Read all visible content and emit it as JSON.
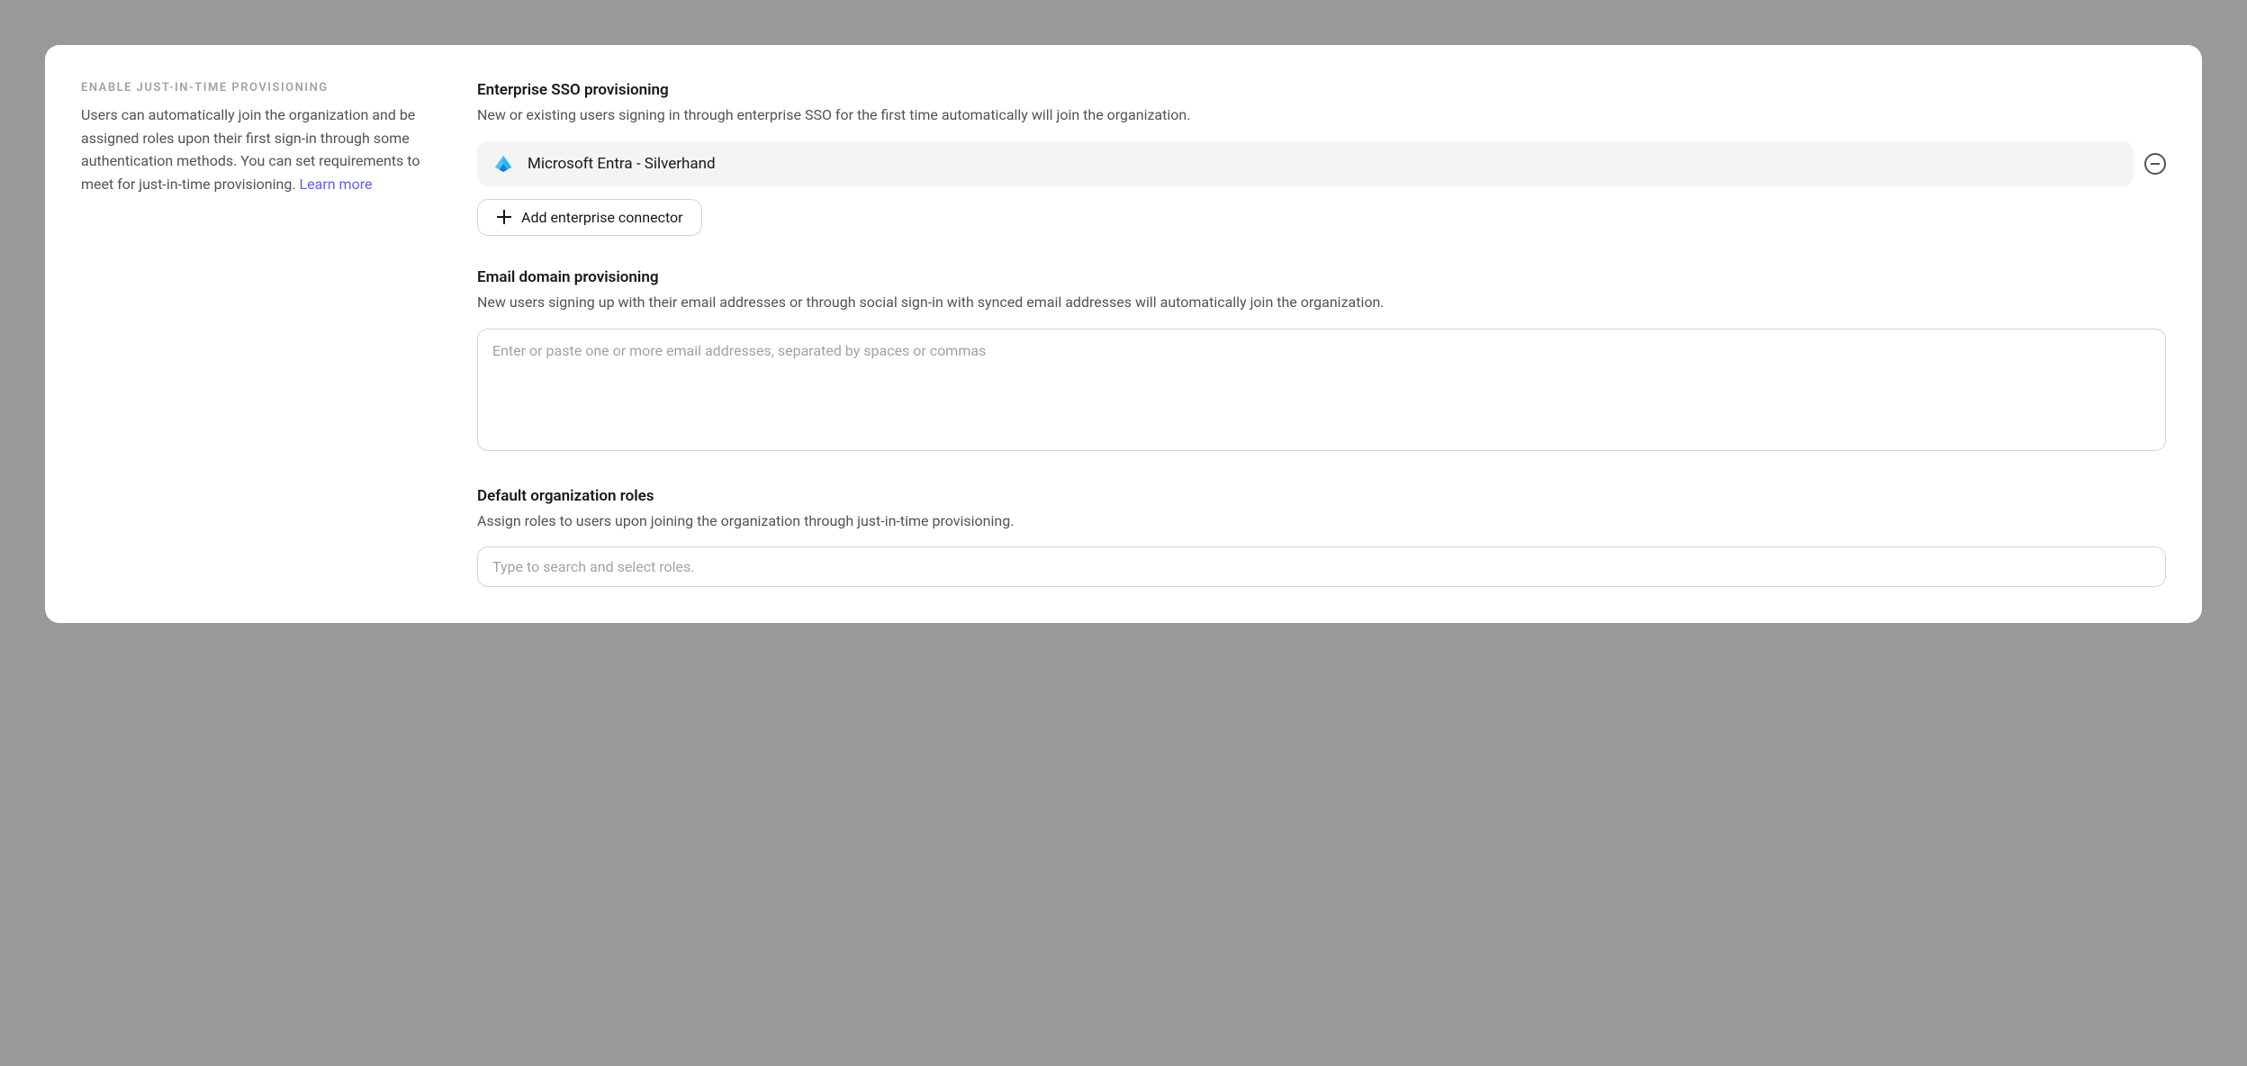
{
  "sidebar": {
    "label": "Enable Just-in-Time Provisioning",
    "description": "Users can automatically join the organization and be assigned roles upon their first sign-in through some authentication methods. You can set requirements to meet for just-in-time provisioning. ",
    "learn_more": "Learn more"
  },
  "sso": {
    "title": "Enterprise SSO provisioning",
    "description": "New or existing users signing in through enterprise SSO for the first time automatically will join the organization.",
    "connectors": [
      {
        "name": "Microsoft Entra - Silverhand",
        "icon": "entra"
      }
    ],
    "add_button": "Add enterprise connector"
  },
  "email_domain": {
    "title": "Email domain provisioning",
    "description": "New users signing up with their email addresses or through social sign-in with synced email addresses will automatically join the organization.",
    "placeholder": "Enter or paste one or more email addresses, separated by spaces or commas",
    "value": ""
  },
  "roles": {
    "title": "Default organization roles",
    "description": "Assign roles to users upon joining the organization through just-in-time provisioning.",
    "placeholder": "Type to search and select roles.",
    "value": ""
  }
}
